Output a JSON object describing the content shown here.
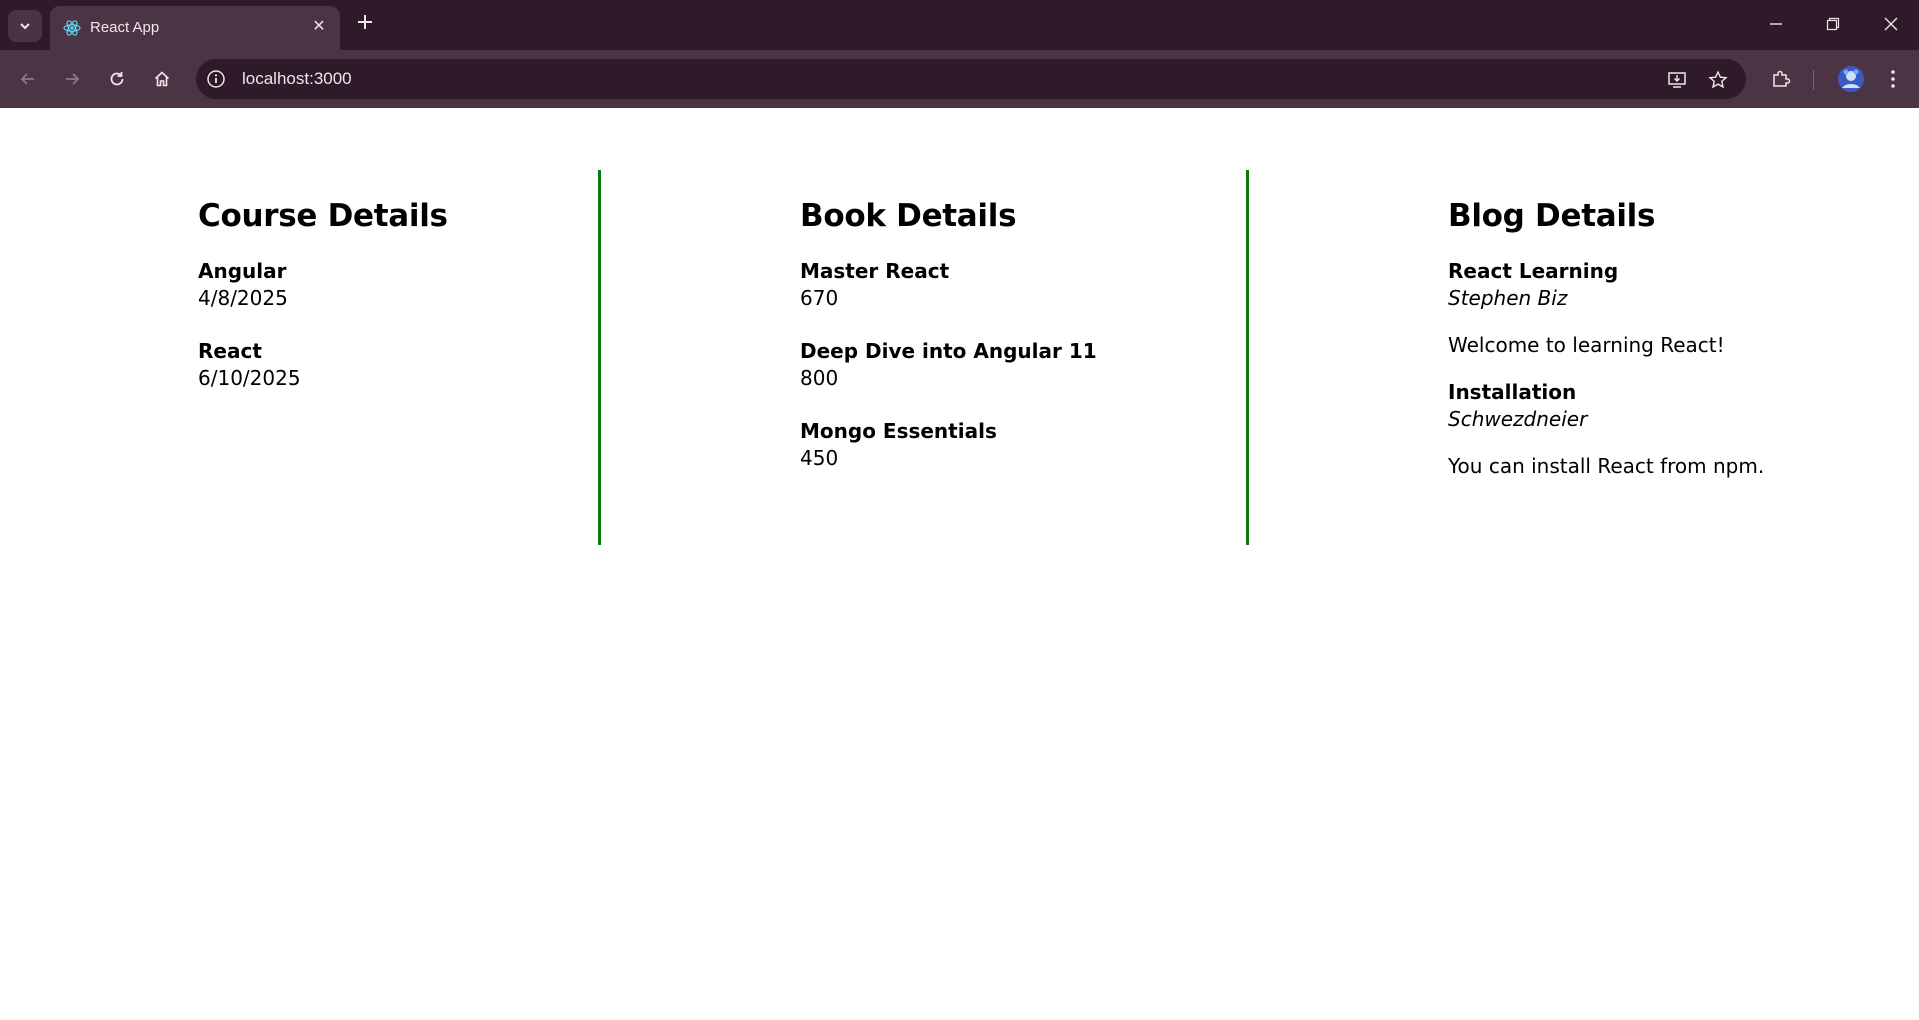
{
  "browser": {
    "tab_title": "React App",
    "url": "localhost:3000",
    "icons": {
      "tab_search": "chevron-down-icon",
      "favicon": "react-logo-icon",
      "close": "close-icon",
      "new_tab": "plus-icon",
      "back": "back-arrow-icon",
      "forward": "forward-arrow-icon",
      "reload": "reload-icon",
      "home": "home-icon",
      "site_info": "info-icon",
      "install": "install-app-icon",
      "bookmark": "star-icon",
      "extensions": "puzzle-icon",
      "profile": "avatar",
      "menu": "kebab-menu-icon"
    }
  },
  "courses": {
    "heading": "Course Details",
    "items": [
      {
        "name": "Angular",
        "date": "4/8/2025"
      },
      {
        "name": "React",
        "date": "6/10/2025"
      }
    ]
  },
  "books": {
    "heading": "Book Details",
    "items": [
      {
        "name": "Master React",
        "price": "670"
      },
      {
        "name": "Deep Dive into Angular 11",
        "price": "800"
      },
      {
        "name": "Mongo Essentials",
        "price": "450"
      }
    ]
  },
  "blogs": {
    "heading": "Blog Details",
    "items": [
      {
        "title": "React Learning",
        "author": "Stephen Biz",
        "content": "Welcome to learning React!"
      },
      {
        "title": "Installation",
        "author": "Schwezdneier",
        "content": "You can install React from npm."
      }
    ]
  },
  "colors": {
    "divider": "#0b7a0b",
    "chrome_dark": "#2e1a28",
    "chrome_mid": "#4b3545"
  }
}
